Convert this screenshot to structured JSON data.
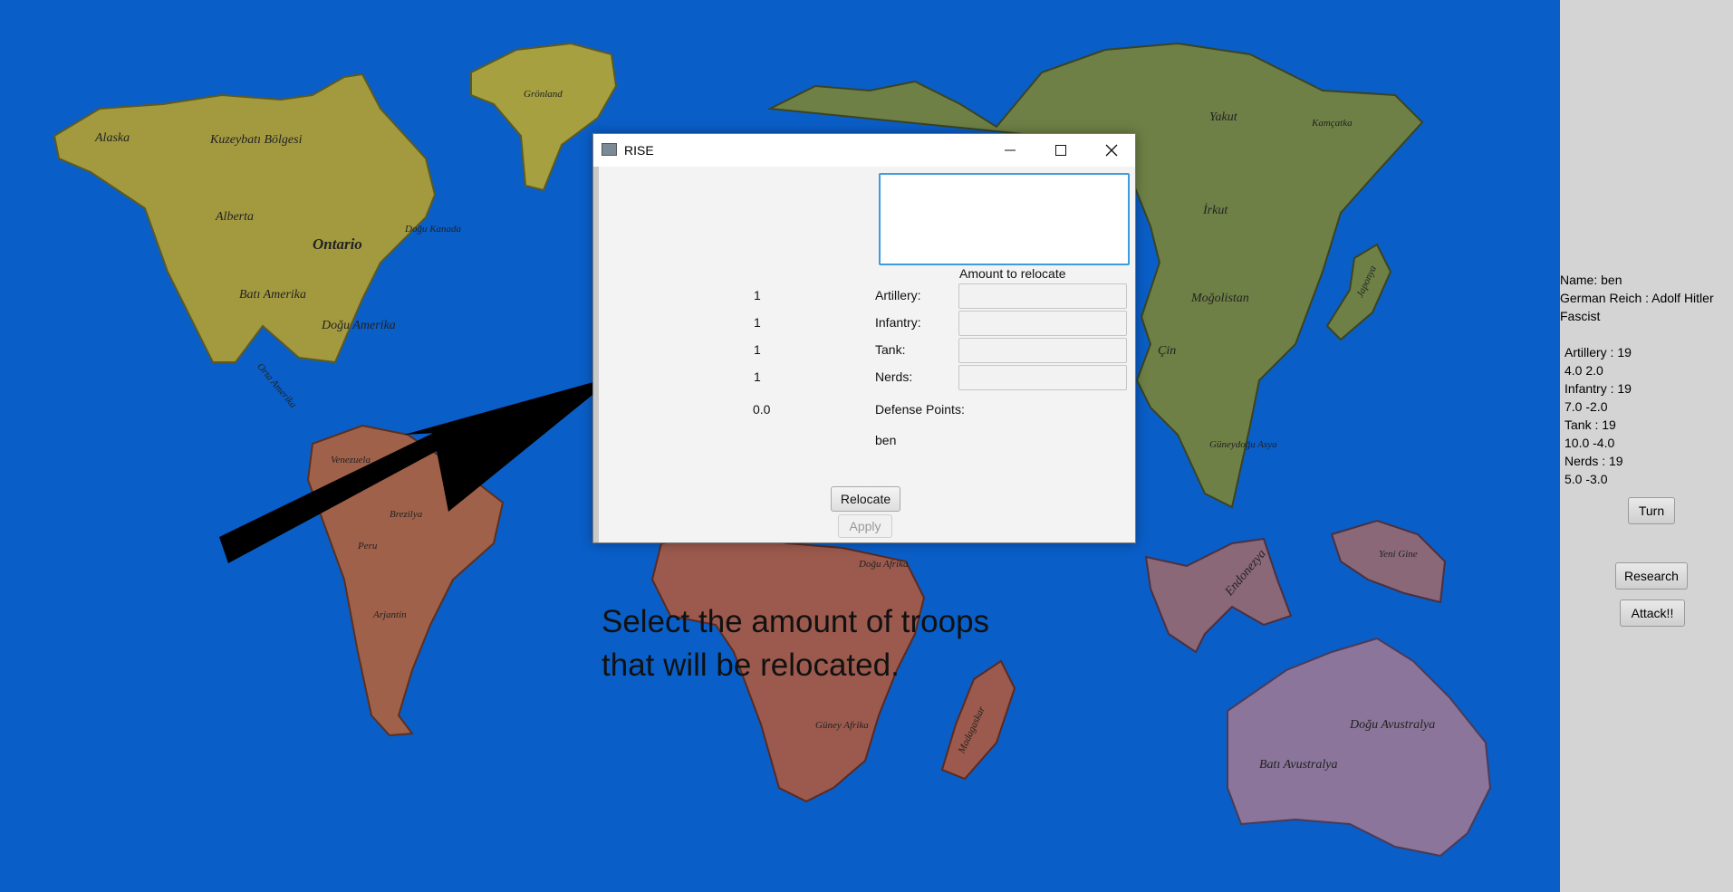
{
  "map": {
    "labels": {
      "alaska": "Alaska",
      "kuzeybati": "Kuzeybatı Bölgesi",
      "gronland": "Grönland",
      "alberta": "Alberta",
      "ontario": "Ontario",
      "dogu_kanada": "Doğu Kanada",
      "bati_amerika": "Batı Amerika",
      "dogu_amerika": "Doğu Amerika",
      "orta_amerika": "Orta Amerika",
      "venezuela": "Venezuela",
      "brezilya": "Brezilya",
      "peru": "Peru",
      "arjantin": "Arjantin",
      "yakut": "Yakut",
      "kamcatka": "Kamçatka",
      "irkut": "İrkut",
      "mogolistan": "Moğolistan",
      "japonya": "Japonya",
      "cin": "Çin",
      "guneydogu_asya": "Güneydoğu Asya",
      "endonezya": "Endonezya",
      "yeni_gine": "Yeni Gine",
      "dogu_afrika": "Doğu Afrika",
      "guney_afrika": "Güney Afrika",
      "madagaskar": "Madagaskar",
      "dogu_avustralya": "Doğu Avustralya",
      "bati_avustralya": "Batı Avustralya"
    }
  },
  "dialog": {
    "title": "RISE",
    "header": "Amount to relocate",
    "rows": [
      {
        "count": "1",
        "label": "Artillery:"
      },
      {
        "count": "1",
        "label": "Infantry:"
      },
      {
        "count": "1",
        "label": "Tank:"
      },
      {
        "count": "1",
        "label": "Nerds:"
      }
    ],
    "defense_value": "0.0",
    "defense_label": "Defense Points:",
    "player": "ben",
    "relocate_label": "Relocate",
    "apply_label": "Apply"
  },
  "caption": {
    "line1": "Select the amount of troops",
    "line2": "that will be relocated."
  },
  "sidebar": {
    "name_line": "Name:  ben",
    "nation_line": " German Reich :  Adolf Hitler",
    "ideology": "  Fascist",
    "stats": [
      "Artillery  :  19",
      "4.0 2.0",
      "Infantry  :  19",
      "7.0 -2.0",
      "Tank  :  19",
      "10.0 -4.0",
      "Nerds  :  19",
      "5.0 -3.0"
    ],
    "turn_label": "Turn",
    "research_label": "Research",
    "attack_label": "Attack!!"
  }
}
